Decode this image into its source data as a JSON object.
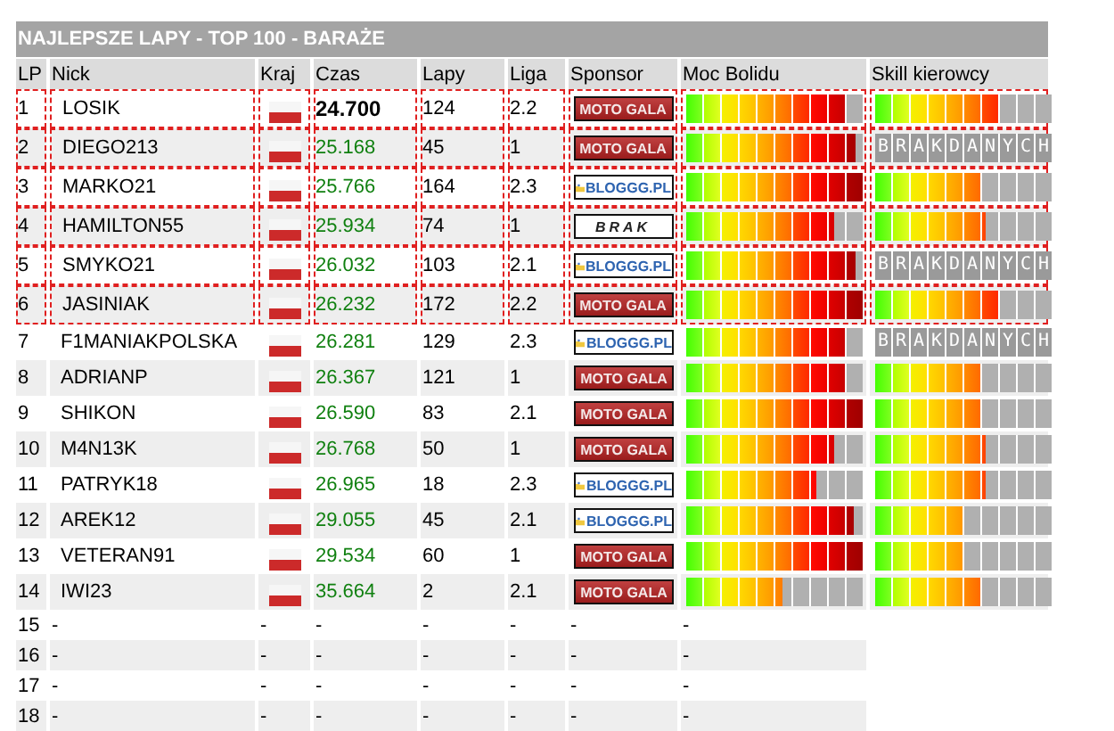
{
  "title": "NAJLEPSZE LAPY - TOP 100 - BARAŻE",
  "columns": [
    "LP",
    "Nick",
    "Kraj",
    "Czas",
    "Lapy",
    "Liga",
    "Sponsor",
    "Moc Bolidu",
    "Skill kierowcy"
  ],
  "rows": [
    {
      "kind": "entry",
      "highlighted": true,
      "best": true,
      "lp": "1",
      "nick": "LOSIK",
      "time": "24.700",
      "laps": "124",
      "league": "2.2",
      "sponsor": {
        "kind": "moto",
        "label": "MOTO GALA"
      },
      "power": {
        "level": 0.9
      },
      "skill": {
        "level": 0.7
      }
    },
    {
      "kind": "entry",
      "highlighted": true,
      "best": false,
      "lp": "2",
      "nick": "DIEGO213",
      "time": "25.168",
      "laps": "45",
      "league": "1",
      "sponsor": {
        "kind": "moto",
        "label": "MOTO GALA"
      },
      "power": {
        "level": 0.96
      },
      "skill": {
        "no_data": "BRAKDANYCH"
      }
    },
    {
      "kind": "entry",
      "highlighted": true,
      "best": false,
      "lp": "3",
      "nick": "MARKO21",
      "time": "25.766",
      "laps": "164",
      "league": "2.3",
      "sponsor": {
        "kind": "blog",
        "label": "BLOGGG.PL"
      },
      "power": {
        "level": 1
      },
      "skill": {
        "level": 0.6
      }
    },
    {
      "kind": "entry",
      "highlighted": true,
      "best": false,
      "lp": "4",
      "nick": "HAMILTON55",
      "time": "25.934",
      "laps": "74",
      "league": "1",
      "sponsor": {
        "kind": "none",
        "label": "BRAK"
      },
      "power": {
        "level": 0.84
      },
      "skill": {
        "level": 0.63
      }
    },
    {
      "kind": "entry",
      "highlighted": true,
      "best": false,
      "lp": "5",
      "nick": "SMYKO21",
      "time": "26.032",
      "laps": "103",
      "league": "2.1",
      "sponsor": {
        "kind": "blog",
        "label": "BLOGGG.PL"
      },
      "power": {
        "level": 0.96
      },
      "skill": {
        "no_data": "BRAKDANYCH"
      }
    },
    {
      "kind": "entry",
      "highlighted": true,
      "best": false,
      "lp": "6",
      "nick": "JASINIAK",
      "time": "26.232",
      "laps": "172",
      "league": "2.2",
      "sponsor": {
        "kind": "moto",
        "label": "MOTO GALA"
      },
      "power": {
        "level": 1
      },
      "skill": {
        "level": 0.7
      }
    },
    {
      "kind": "entry",
      "highlighted": false,
      "best": false,
      "lp": "7",
      "nick": "F1MANIAKPOLSKA",
      "time": "26.281",
      "laps": "129",
      "league": "2.3",
      "sponsor": {
        "kind": "blog",
        "label": "BLOGGG.PL"
      },
      "power": {
        "level": 0.9
      },
      "skill": {
        "no_data": "BRAKDANYCH"
      }
    },
    {
      "kind": "entry",
      "highlighted": false,
      "best": false,
      "lp": "8",
      "nick": "ADRIANP",
      "time": "26.367",
      "laps": "121",
      "league": "1",
      "sponsor": {
        "kind": "moto",
        "label": "MOTO GALA"
      },
      "power": {
        "level": 0.9
      },
      "skill": {
        "level": 0.6
      }
    },
    {
      "kind": "entry",
      "highlighted": false,
      "best": false,
      "lp": "9",
      "nick": "SHIKON",
      "time": "26.590",
      "laps": "83",
      "league": "2.1",
      "sponsor": {
        "kind": "moto",
        "label": "MOTO GALA"
      },
      "power": {
        "level": 1
      },
      "skill": {
        "level": 0.6
      }
    },
    {
      "kind": "entry",
      "highlighted": false,
      "best": false,
      "lp": "10",
      "nick": "M4N13K",
      "time": "26.768",
      "laps": "50",
      "league": "1",
      "sponsor": {
        "kind": "moto",
        "label": "MOTO GALA"
      },
      "power": {
        "level": 0.84
      },
      "skill": {
        "level": 0.63
      }
    },
    {
      "kind": "entry",
      "highlighted": false,
      "best": false,
      "lp": "11",
      "nick": "PATRYK18",
      "time": "26.965",
      "laps": "18",
      "league": "2.3",
      "sponsor": {
        "kind": "blog",
        "label": "BLOGGG.PL"
      },
      "power": {
        "level": 0.74
      },
      "skill": {
        "level": 0.63
      }
    },
    {
      "kind": "entry",
      "highlighted": false,
      "best": false,
      "lp": "12",
      "nick": "AREK12",
      "time": "29.055",
      "laps": "45",
      "league": "2.1",
      "sponsor": {
        "kind": "blog",
        "label": "BLOGGG.PL"
      },
      "power": {
        "level": 0.95
      },
      "skill": {
        "level": 0.5
      }
    },
    {
      "kind": "entry",
      "highlighted": false,
      "best": false,
      "lp": "13",
      "nick": "VETERAN91",
      "time": "29.534",
      "laps": "60",
      "league": "1",
      "sponsor": {
        "kind": "moto",
        "label": "MOTO GALA"
      },
      "power": {
        "level": 1
      },
      "skill": {
        "level": 0.5
      }
    },
    {
      "kind": "entry",
      "highlighted": false,
      "best": false,
      "lp": "14",
      "nick": "IWI23",
      "time": "35.664",
      "laps": "2",
      "league": "2.1",
      "sponsor": {
        "kind": "moto",
        "label": "MOTO GALA"
      },
      "power": {
        "level": 0.55
      },
      "skill": {
        "level": 0.6
      }
    },
    {
      "kind": "empty",
      "lp": "15",
      "nick": "-",
      "country": "-",
      "time": "-",
      "laps": "-",
      "league": "-",
      "sponsor": "-",
      "power": "-"
    },
    {
      "kind": "empty",
      "lp": "16",
      "nick": "-",
      "country": "-",
      "time": "-",
      "laps": "-",
      "league": "-",
      "sponsor": "-",
      "power": "-"
    },
    {
      "kind": "empty",
      "lp": "17",
      "nick": "-",
      "country": "-",
      "time": "-",
      "laps": "-",
      "league": "-",
      "sponsor": "-",
      "power": "-"
    },
    {
      "kind": "empty",
      "lp": "18",
      "nick": "-",
      "country": "-",
      "time": "-",
      "laps": "-",
      "league": "-",
      "sponsor": "-",
      "power": "-"
    }
  ]
}
